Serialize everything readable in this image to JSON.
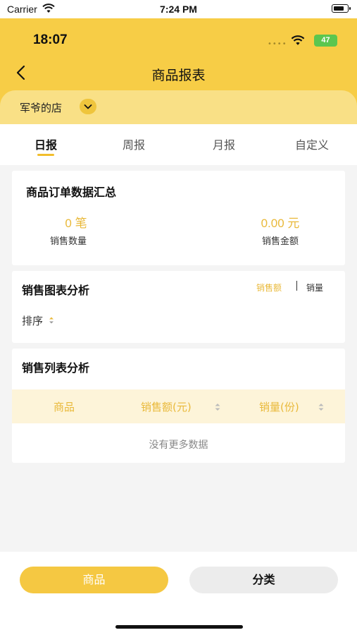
{
  "system_status": {
    "carrier": "Carrier",
    "time": "7:24 PM"
  },
  "app_status": {
    "time": "18:07",
    "battery": "47"
  },
  "header": {
    "title": "商品报表"
  },
  "store": {
    "name": "军爷的店"
  },
  "tabs": [
    {
      "label": "日报",
      "active": true
    },
    {
      "label": "周报"
    },
    {
      "label": "月报"
    },
    {
      "label": "自定义"
    }
  ],
  "summary": {
    "title": "商品订单数据汇总",
    "count_value": "0 笔",
    "count_label": "销售数量",
    "amount_value": "0.00 元",
    "amount_label": "销售金额"
  },
  "chart_section": {
    "title": "销售图表分析",
    "toggle_amount": "销售额",
    "toggle_quantity": "销量",
    "sort_label": "排序"
  },
  "list_section": {
    "title": "销售列表分析",
    "columns": [
      "商品",
      "销售额(元)",
      "销量(份)"
    ],
    "empty_text": "没有更多数据"
  },
  "bottom_buttons": {
    "product": "商品",
    "category": "分类"
  },
  "colors": {
    "brand_yellow": "#f7cd46",
    "accent": "#e9b93a",
    "store_bar": "#f9e086"
  }
}
